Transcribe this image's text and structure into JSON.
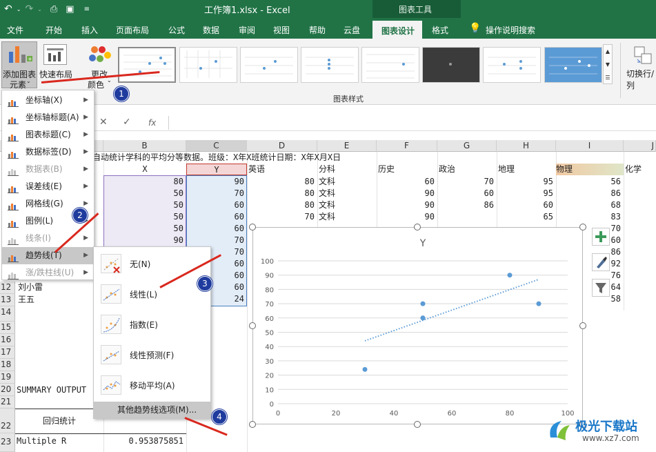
{
  "title": {
    "doc": "工作簿1.xlsx  -  Excel",
    "chart_tools": "图表工具"
  },
  "tabs": [
    "文件",
    "开始",
    "插入",
    "页面布局",
    "公式",
    "数据",
    "审阅",
    "视图",
    "帮助",
    "云盘",
    "图表设计",
    "格式",
    "操作说明搜索"
  ],
  "active_tab": "图表设计",
  "ribbon": {
    "add_element_line1": "添加图表",
    "add_element_line2": "元素",
    "quick_layout": "快速布局",
    "change_colors_line1": "更改",
    "change_colors_line2": "颜色",
    "styles_group": "图表样式",
    "switch_rowcol": "切换行/列"
  },
  "formula_bar": {
    "cancel": "✕",
    "enter": "✓",
    "fx": "fx"
  },
  "columns": [
    "B",
    "C",
    "D",
    "E",
    "F",
    "G",
    "H",
    "I",
    "J"
  ],
  "rows": [
    "12",
    "13",
    "14",
    "15",
    "16",
    "17",
    "18",
    "19",
    "20",
    "21",
    "22",
    "23"
  ],
  "sheet": {
    "b1": "自动统计学科的平均分等数据。班级：X年X班统计日期：X年X月X日",
    "header": [
      "X",
      "Y",
      "英语",
      "分科",
      "历史",
      "政治",
      "地理",
      "物理",
      "化学"
    ],
    "colB": [
      "80",
      "50",
      "50",
      "50",
      "50",
      "90"
    ],
    "colC": [
      "90",
      "70",
      "60",
      "60",
      "60",
      "70",
      "70",
      "60",
      "60",
      "60",
      "24"
    ],
    "colD": [
      "80",
      "80",
      "80",
      "70"
    ],
    "colE": [
      "文科",
      "文科",
      "文科",
      "文科"
    ],
    "colF": [
      "60",
      "90",
      "90",
      "90"
    ],
    "colG": [
      "70",
      "60",
      "86",
      ""
    ],
    "colH": [
      "95",
      "95",
      "60",
      "65"
    ],
    "colI": [
      "56",
      "86",
      "68",
      "83",
      "70",
      "60",
      "86",
      "92",
      "76",
      "64",
      "58"
    ],
    "a12": "刘小雷",
    "a13": "王五",
    "a20": "SUMMARY OUTPUT",
    "a22": "回归统计",
    "a23": "Multiple R",
    "b23": "0.953875851"
  },
  "menu": {
    "items": [
      {
        "label": "坐标轴(X)",
        "icon": "axes-icon",
        "disabled": false
      },
      {
        "label": "坐标轴标题(A)",
        "icon": "axis-title-icon",
        "disabled": false
      },
      {
        "label": "图表标题(C)",
        "icon": "chart-title-icon",
        "disabled": false
      },
      {
        "label": "数据标签(D)",
        "icon": "data-labels-icon",
        "disabled": false
      },
      {
        "label": "数据表(B)",
        "icon": "data-table-icon",
        "disabled": true
      },
      {
        "label": "误差线(E)",
        "icon": "error-bars-icon",
        "disabled": false
      },
      {
        "label": "网格线(G)",
        "icon": "gridlines-icon",
        "disabled": false
      },
      {
        "label": "图例(L)",
        "icon": "legend-icon",
        "disabled": false
      },
      {
        "label": "线条(I)",
        "icon": "lines-icon",
        "disabled": true
      },
      {
        "label": "趋势线(T)",
        "icon": "trendline-icon",
        "disabled": false
      },
      {
        "label": "涨/跌柱线(U)",
        "icon": "updown-bars-icon",
        "disabled": true
      }
    ],
    "highlighted": "趋势线(T)"
  },
  "submenu": {
    "items": [
      "无(N)",
      "线性(L)",
      "指数(E)",
      "线性预测(F)",
      "移动平均(A)"
    ],
    "more": "其他趋势线选项(M)..."
  },
  "badges": [
    "1",
    "2",
    "3",
    "4"
  ],
  "watermark": {
    "text": "极光下载站",
    "url": "www.xz7.com"
  },
  "colors": {
    "excel_green": "#217346",
    "accent_blue": "#5b9bd5",
    "arrow_red": "#d9281e",
    "badge_blue": "#1f3b9e"
  },
  "chart_data": {
    "type": "scatter",
    "title": "Y",
    "x": [
      80,
      50,
      50,
      50,
      90,
      30
    ],
    "y": [
      90,
      70,
      60,
      60,
      70,
      24
    ],
    "trendline": {
      "kind": "linear",
      "from": [
        30,
        44
      ],
      "to": [
        90,
        87
      ]
    },
    "xlim": [
      0,
      100
    ],
    "ylim": [
      0,
      100
    ],
    "xticks": [
      0,
      20,
      40,
      60,
      80,
      100
    ],
    "yticks": [
      0,
      10,
      20,
      30,
      40,
      50,
      60,
      70,
      80,
      90,
      100
    ],
    "grid": "horizontal",
    "point_color": "#5b9bd5"
  }
}
